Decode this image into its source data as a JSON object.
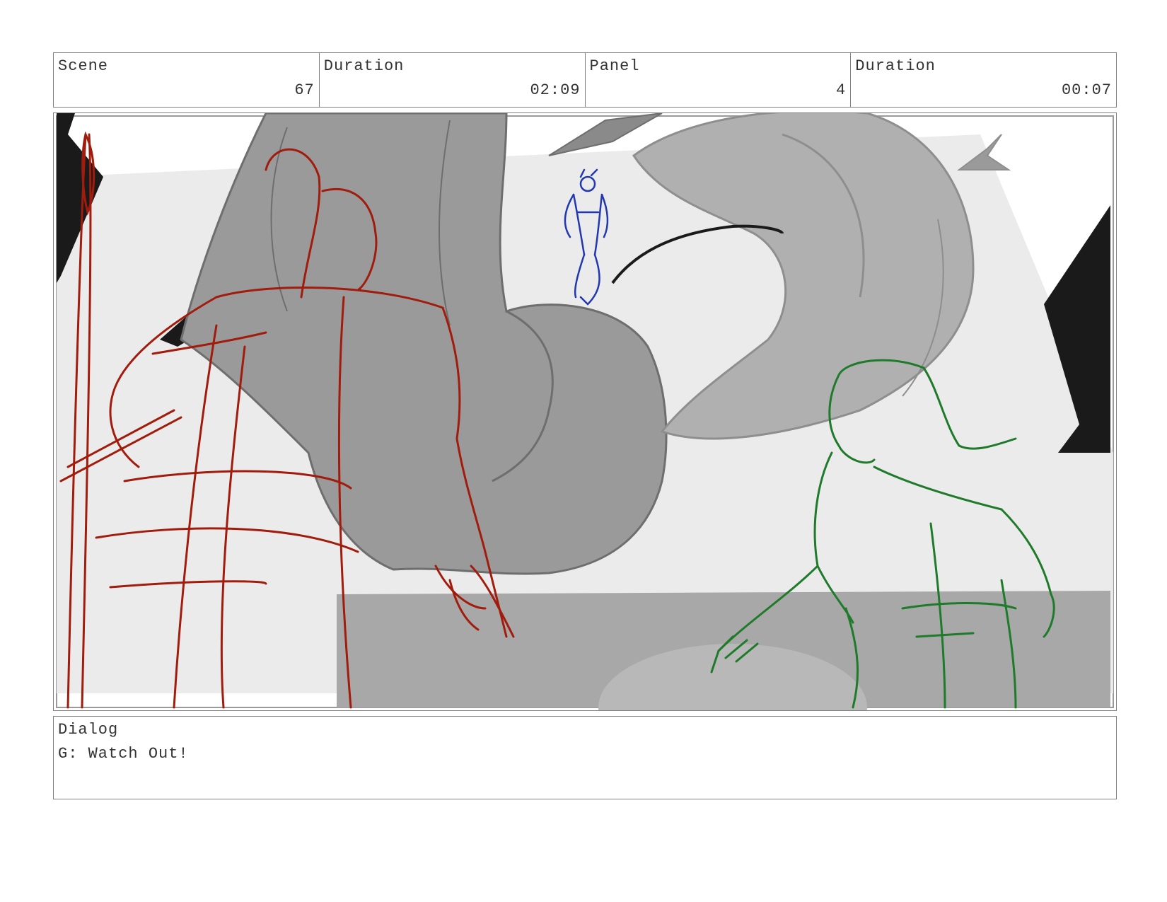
{
  "header": {
    "scene_label": "Scene",
    "scene_value": "67",
    "scene_duration_label": "Duration",
    "scene_duration_value": "02:09",
    "panel_label": "Panel",
    "panel_value": "4",
    "panel_duration_label": "Duration",
    "panel_duration_value": "00:07"
  },
  "panel_art": {
    "background_color": "#ebebeb",
    "dark_color": "#1a1a1a",
    "creature_color": "#9a9a9a",
    "creature_light_color": "#b0b0b0",
    "red_character_color": "#a11c0c",
    "blue_character_color": "#2238b0",
    "green_character_color": "#1f7a2a"
  },
  "dialog": {
    "label": "Dialog",
    "text": "G: Watch Out!"
  }
}
